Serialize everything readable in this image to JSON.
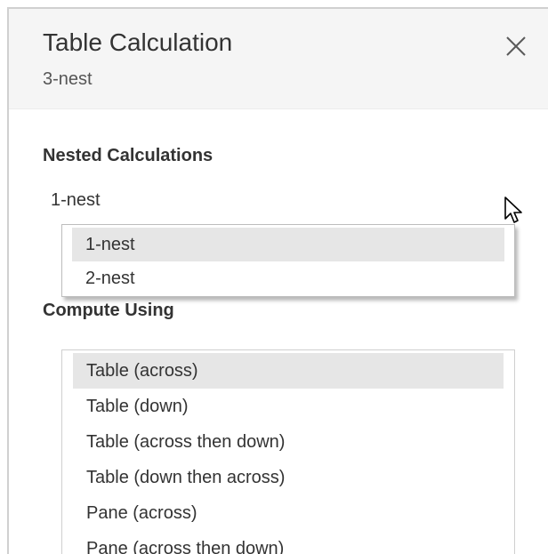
{
  "header": {
    "title": "Table Calculation",
    "subtitle": "3-nest"
  },
  "icons": {
    "close": "close-icon",
    "cursor": "mouse-pointer-icon"
  },
  "nested": {
    "label": "Nested Calculations",
    "selected_value": "1-nest",
    "options": [
      "1-nest",
      "2-nest"
    ]
  },
  "compute": {
    "label": "Compute Using",
    "items": [
      "Table (across)",
      "Table (down)",
      "Table (across then down)",
      "Table (down then across)",
      "Pane (across)",
      "Pane (across then down)"
    ],
    "selected_index": 0
  },
  "colors": {
    "header_bg": "#f5f5f5",
    "selected_bg": "#e6e6e6",
    "text": "#333333"
  }
}
